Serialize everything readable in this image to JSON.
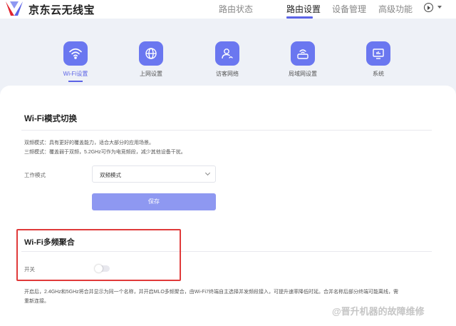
{
  "header": {
    "brand": "京东云无线宝",
    "nav": [
      {
        "label": "路由状态"
      },
      {
        "label": "路由设置"
      },
      {
        "label": "设备管理"
      },
      {
        "label": "高级功能"
      }
    ],
    "accent": "#5b63e6"
  },
  "tiles": [
    {
      "label": "Wi-Fi设置",
      "icon": "wifi-icon"
    },
    {
      "label": "上网设置",
      "icon": "globe-icon"
    },
    {
      "label": "访客网络",
      "icon": "guest-user-icon"
    },
    {
      "label": "局域网设置",
      "icon": "router-icon"
    },
    {
      "label": "系统",
      "icon": "monitor-icon"
    }
  ],
  "mode_section": {
    "title": "Wi-Fi模式切换",
    "desc1": "双频模式：具有更好的覆盖能力，适合大部分的应用场景。",
    "desc2": "三频模式：覆盖弱于双频，5.2GHz可作为电竞频段，减少其他设备干扰。",
    "field_label": "工作模式",
    "select_value": "双频模式",
    "save_label": "保存"
  },
  "mlo_section": {
    "title": "Wi-Fi多频聚合",
    "toggle_label": "开关",
    "toggle_on": false,
    "desc1": "开启后，2.4GHz和5GHz将合并显示为同一个名称，并开启MLO多频聚合，由Wi-Fi7终端自主选择并发频段接入，可提升速率降低时延。合并名称后部分终端可能离线，需",
    "desc2": "重新连接。"
  },
  "watermark": "@晋升机器的故障维修"
}
